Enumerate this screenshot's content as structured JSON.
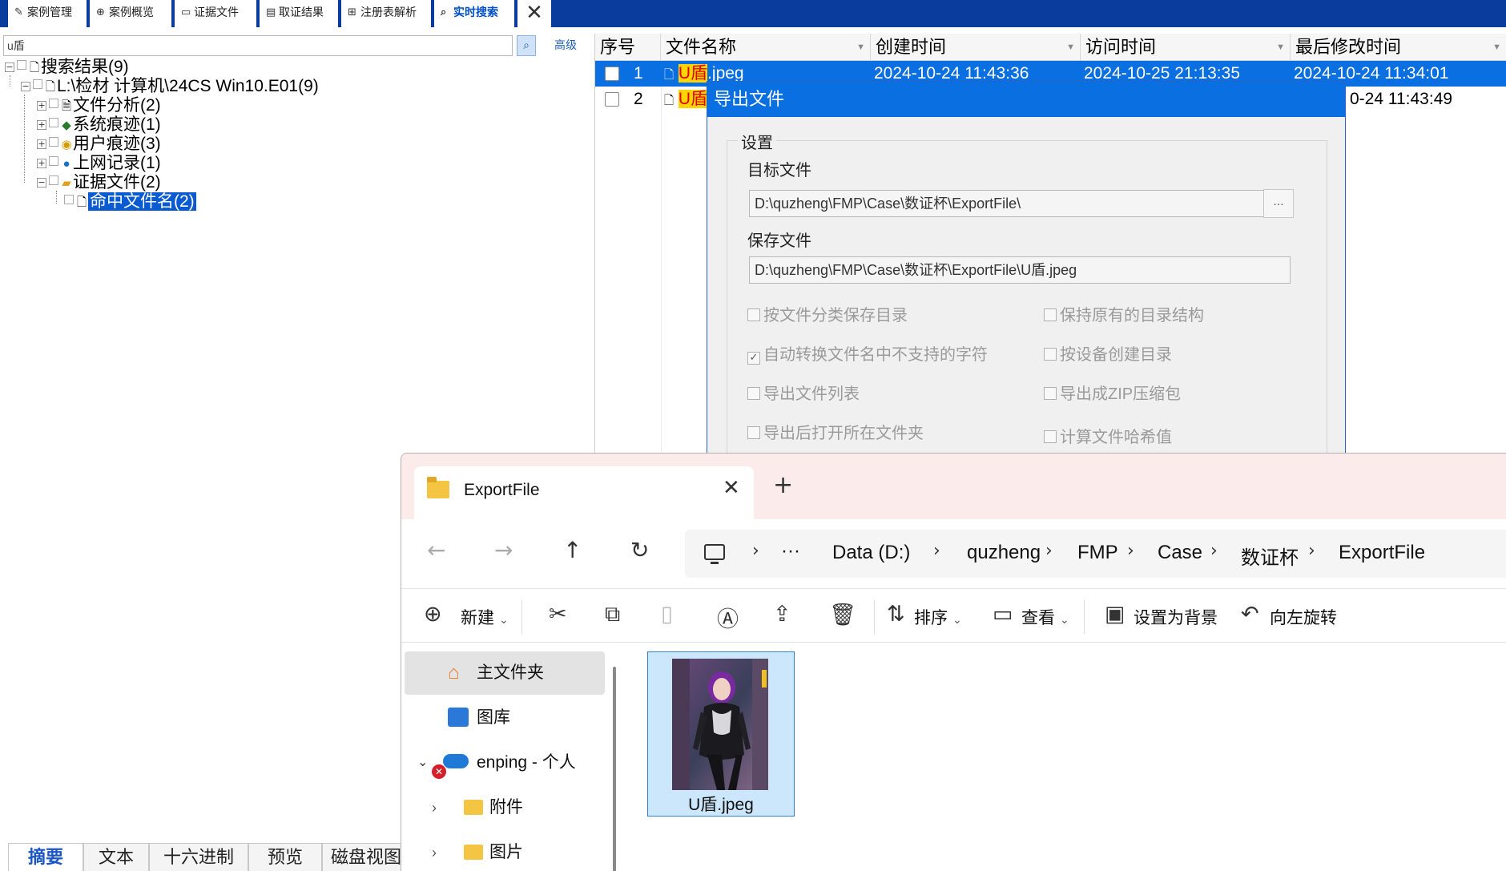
{
  "top_tabs": [
    {
      "label": "案例管理",
      "icon": "edit-icon"
    },
    {
      "label": "案例概览",
      "icon": "overview-icon"
    },
    {
      "label": "证据文件",
      "icon": "evidence-file-icon"
    },
    {
      "label": "取证结果",
      "icon": "result-icon"
    },
    {
      "label": "注册表解析",
      "icon": "registry-icon"
    },
    {
      "label": "实时搜索",
      "icon": "search-icon",
      "active": true
    }
  ],
  "search": {
    "value": "u盾",
    "advanced_label": "高级"
  },
  "tree": {
    "root": "搜索结果(9)",
    "source": "L:\\检材 计算机\\24CS Win10.E01(9)",
    "items": [
      "文件分析(2)",
      "系统痕迹(1)",
      "用户痕迹(3)",
      "上网记录(1)",
      "证据文件(2)"
    ],
    "child": "命中文件名(2)"
  },
  "bottom_tabs": [
    "摘要",
    "文本",
    "十六进制",
    "预览",
    "磁盘视图"
  ],
  "grid": {
    "columns": [
      "序号",
      "文件名称",
      "创建时间",
      "访问时间",
      "最后修改时间"
    ],
    "rows": [
      {
        "index": "1",
        "hit": "U盾",
        "name_rest": ".jpeg",
        "created": "2024-10-24 11:43:36",
        "accessed": "2024-10-25 21:13:35",
        "modified": "2024-10-24 11:34:01"
      },
      {
        "index": "2",
        "hit": "U盾",
        "name_rest": "",
        "created": "",
        "accessed": "",
        "modified": "0-24 11:43:49"
      }
    ]
  },
  "export_dialog": {
    "title": "导出文件",
    "group_label": "设置",
    "target_label": "目标文件",
    "target_path": "D:\\quzheng\\FMP\\Case\\数证杯\\ExportFile\\",
    "browse_label": "...",
    "save_label": "保存文件",
    "save_path": "D:\\quzheng\\FMP\\Case\\数证杯\\ExportFile\\U盾.jpeg",
    "options": [
      {
        "label": "按文件分类保存目录",
        "checked": false
      },
      {
        "label": "保持原有的目录结构",
        "checked": false
      },
      {
        "label": "自动转换文件名中不支持的字符",
        "checked": true
      },
      {
        "label": "按设备创建目录",
        "checked": false
      },
      {
        "label": "导出文件列表",
        "checked": false
      },
      {
        "label": "导出成ZIP压缩包",
        "checked": false
      },
      {
        "label": "导出后打开所在文件夹",
        "checked": false
      },
      {
        "label": "计算文件哈希值",
        "checked": false
      }
    ]
  },
  "explorer": {
    "tab_title": "ExportFile",
    "breadcrumb": [
      "Data (D:)",
      "quzheng",
      "FMP",
      "Case",
      "数证杯",
      "ExportFile"
    ],
    "ellipsis": "···",
    "toolbar": {
      "new": "新建",
      "sort": "排序",
      "view": "查看",
      "set_background": "设置为背景",
      "rotate_left": "向左旋转"
    },
    "sidebar": [
      {
        "label": "主文件夹",
        "icon": "home-icon"
      },
      {
        "label": "图库",
        "icon": "gallery-icon"
      },
      {
        "label": "enping - 个人",
        "icon": "onedrive-icon"
      },
      {
        "label": "附件",
        "icon": "folder-icon"
      },
      {
        "label": "图片",
        "icon": "folder-icon"
      }
    ],
    "file": {
      "name": "U盾.jpeg"
    }
  },
  "colors": {
    "title_blue": "#0a3c9e",
    "selection_blue": "#0a6fe0",
    "highlight_yellow": "#ffd400",
    "highlight_red": "#e00000"
  }
}
